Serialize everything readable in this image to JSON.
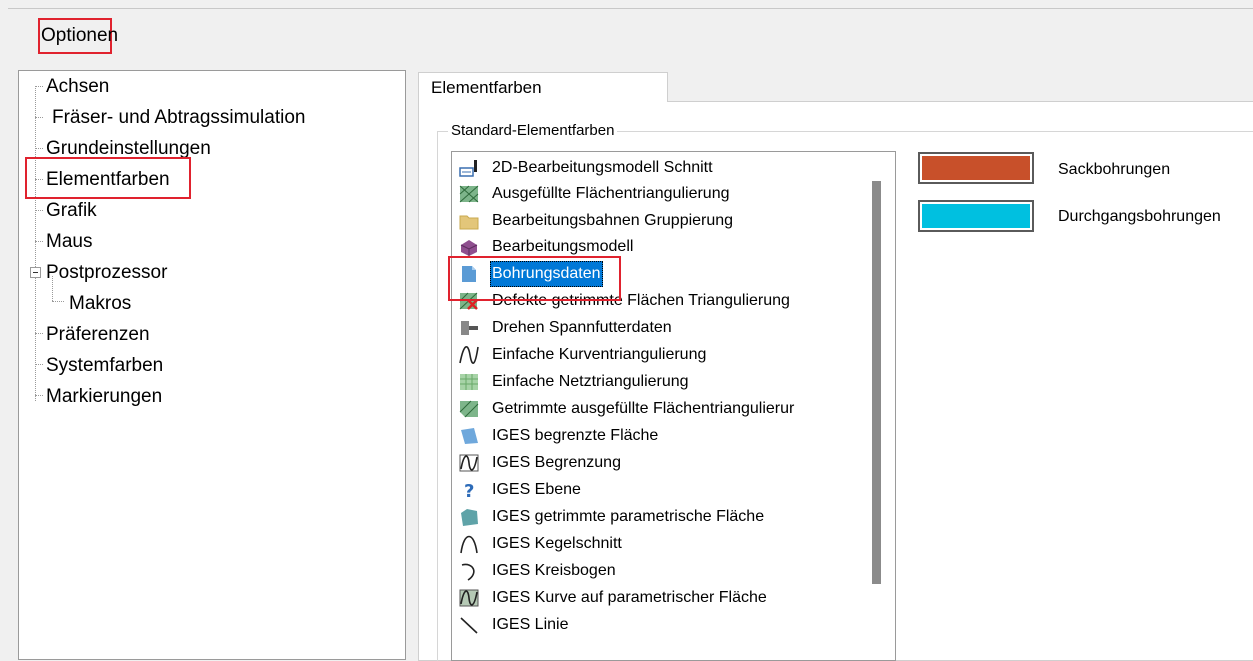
{
  "window": {
    "title": "Optionen"
  },
  "tree": {
    "items": [
      {
        "label": "Achsen"
      },
      {
        "label": "Fräser- und Abtragssimulation"
      },
      {
        "label": "Grundeinstellungen"
      },
      {
        "label": "Elementfarben"
      },
      {
        "label": "Grafik"
      },
      {
        "label": "Maus"
      },
      {
        "label": "Postprozessor"
      },
      {
        "label": "Makros"
      },
      {
        "label": "Präferenzen"
      },
      {
        "label": "Systemfarben"
      },
      {
        "label": "Markierungen"
      }
    ]
  },
  "tab": {
    "label": "Elementfarben"
  },
  "group": {
    "label": "Standard-Elementfarben"
  },
  "list": {
    "selected": "Bohrungsdaten",
    "items": [
      {
        "label": "2D-Bearbeitungsmodell Schnitt",
        "icon": "section-2d-icon"
      },
      {
        "label": "Ausgefüllte Flächentriangulierung",
        "icon": "filled-triangulation-icon"
      },
      {
        "label": "Bearbeitungsbahnen Gruppierung",
        "icon": "folder-icon"
      },
      {
        "label": "Bearbeitungsmodell",
        "icon": "machining-model-icon"
      },
      {
        "label": "Bohrungsdaten",
        "icon": "hole-data-icon"
      },
      {
        "label": "Defekte getrimmte Flächen Triangulierung",
        "icon": "defective-triangulation-icon"
      },
      {
        "label": "Drehen Spannfutterdaten",
        "icon": "chuck-icon"
      },
      {
        "label": "Einfache Kurventriangulierung",
        "icon": "curve-icon"
      },
      {
        "label": "Einfache Netztriangulierung",
        "icon": "mesh-icon"
      },
      {
        "label": "Getrimmte ausgefüllte Flächentriangulierur",
        "icon": "trimmed-triangulation-icon"
      },
      {
        "label": "IGES begrenzte Fläche",
        "icon": "bounded-surface-icon"
      },
      {
        "label": "IGES Begrenzung",
        "icon": "boundary-icon"
      },
      {
        "label": "IGES Ebene",
        "icon": "question-icon"
      },
      {
        "label": "IGES getrimmte parametrische Fläche",
        "icon": "trimmed-surface-icon"
      },
      {
        "label": "IGES Kegelschnitt",
        "icon": "conic-icon"
      },
      {
        "label": "IGES Kreisbogen",
        "icon": "arc-icon"
      },
      {
        "label": "IGES Kurve auf parametrischer Fläche",
        "icon": "curve-on-surface-icon"
      },
      {
        "label": "IGES Linie",
        "icon": "line-icon"
      }
    ]
  },
  "colors": [
    {
      "label": "Sackbohrungen",
      "color": "#c8502a"
    },
    {
      "label": "Durchgangsbohrungen",
      "color": "#00c0e0"
    }
  ],
  "annotation_color": "#e0222e",
  "selection_color": "#0078d7"
}
